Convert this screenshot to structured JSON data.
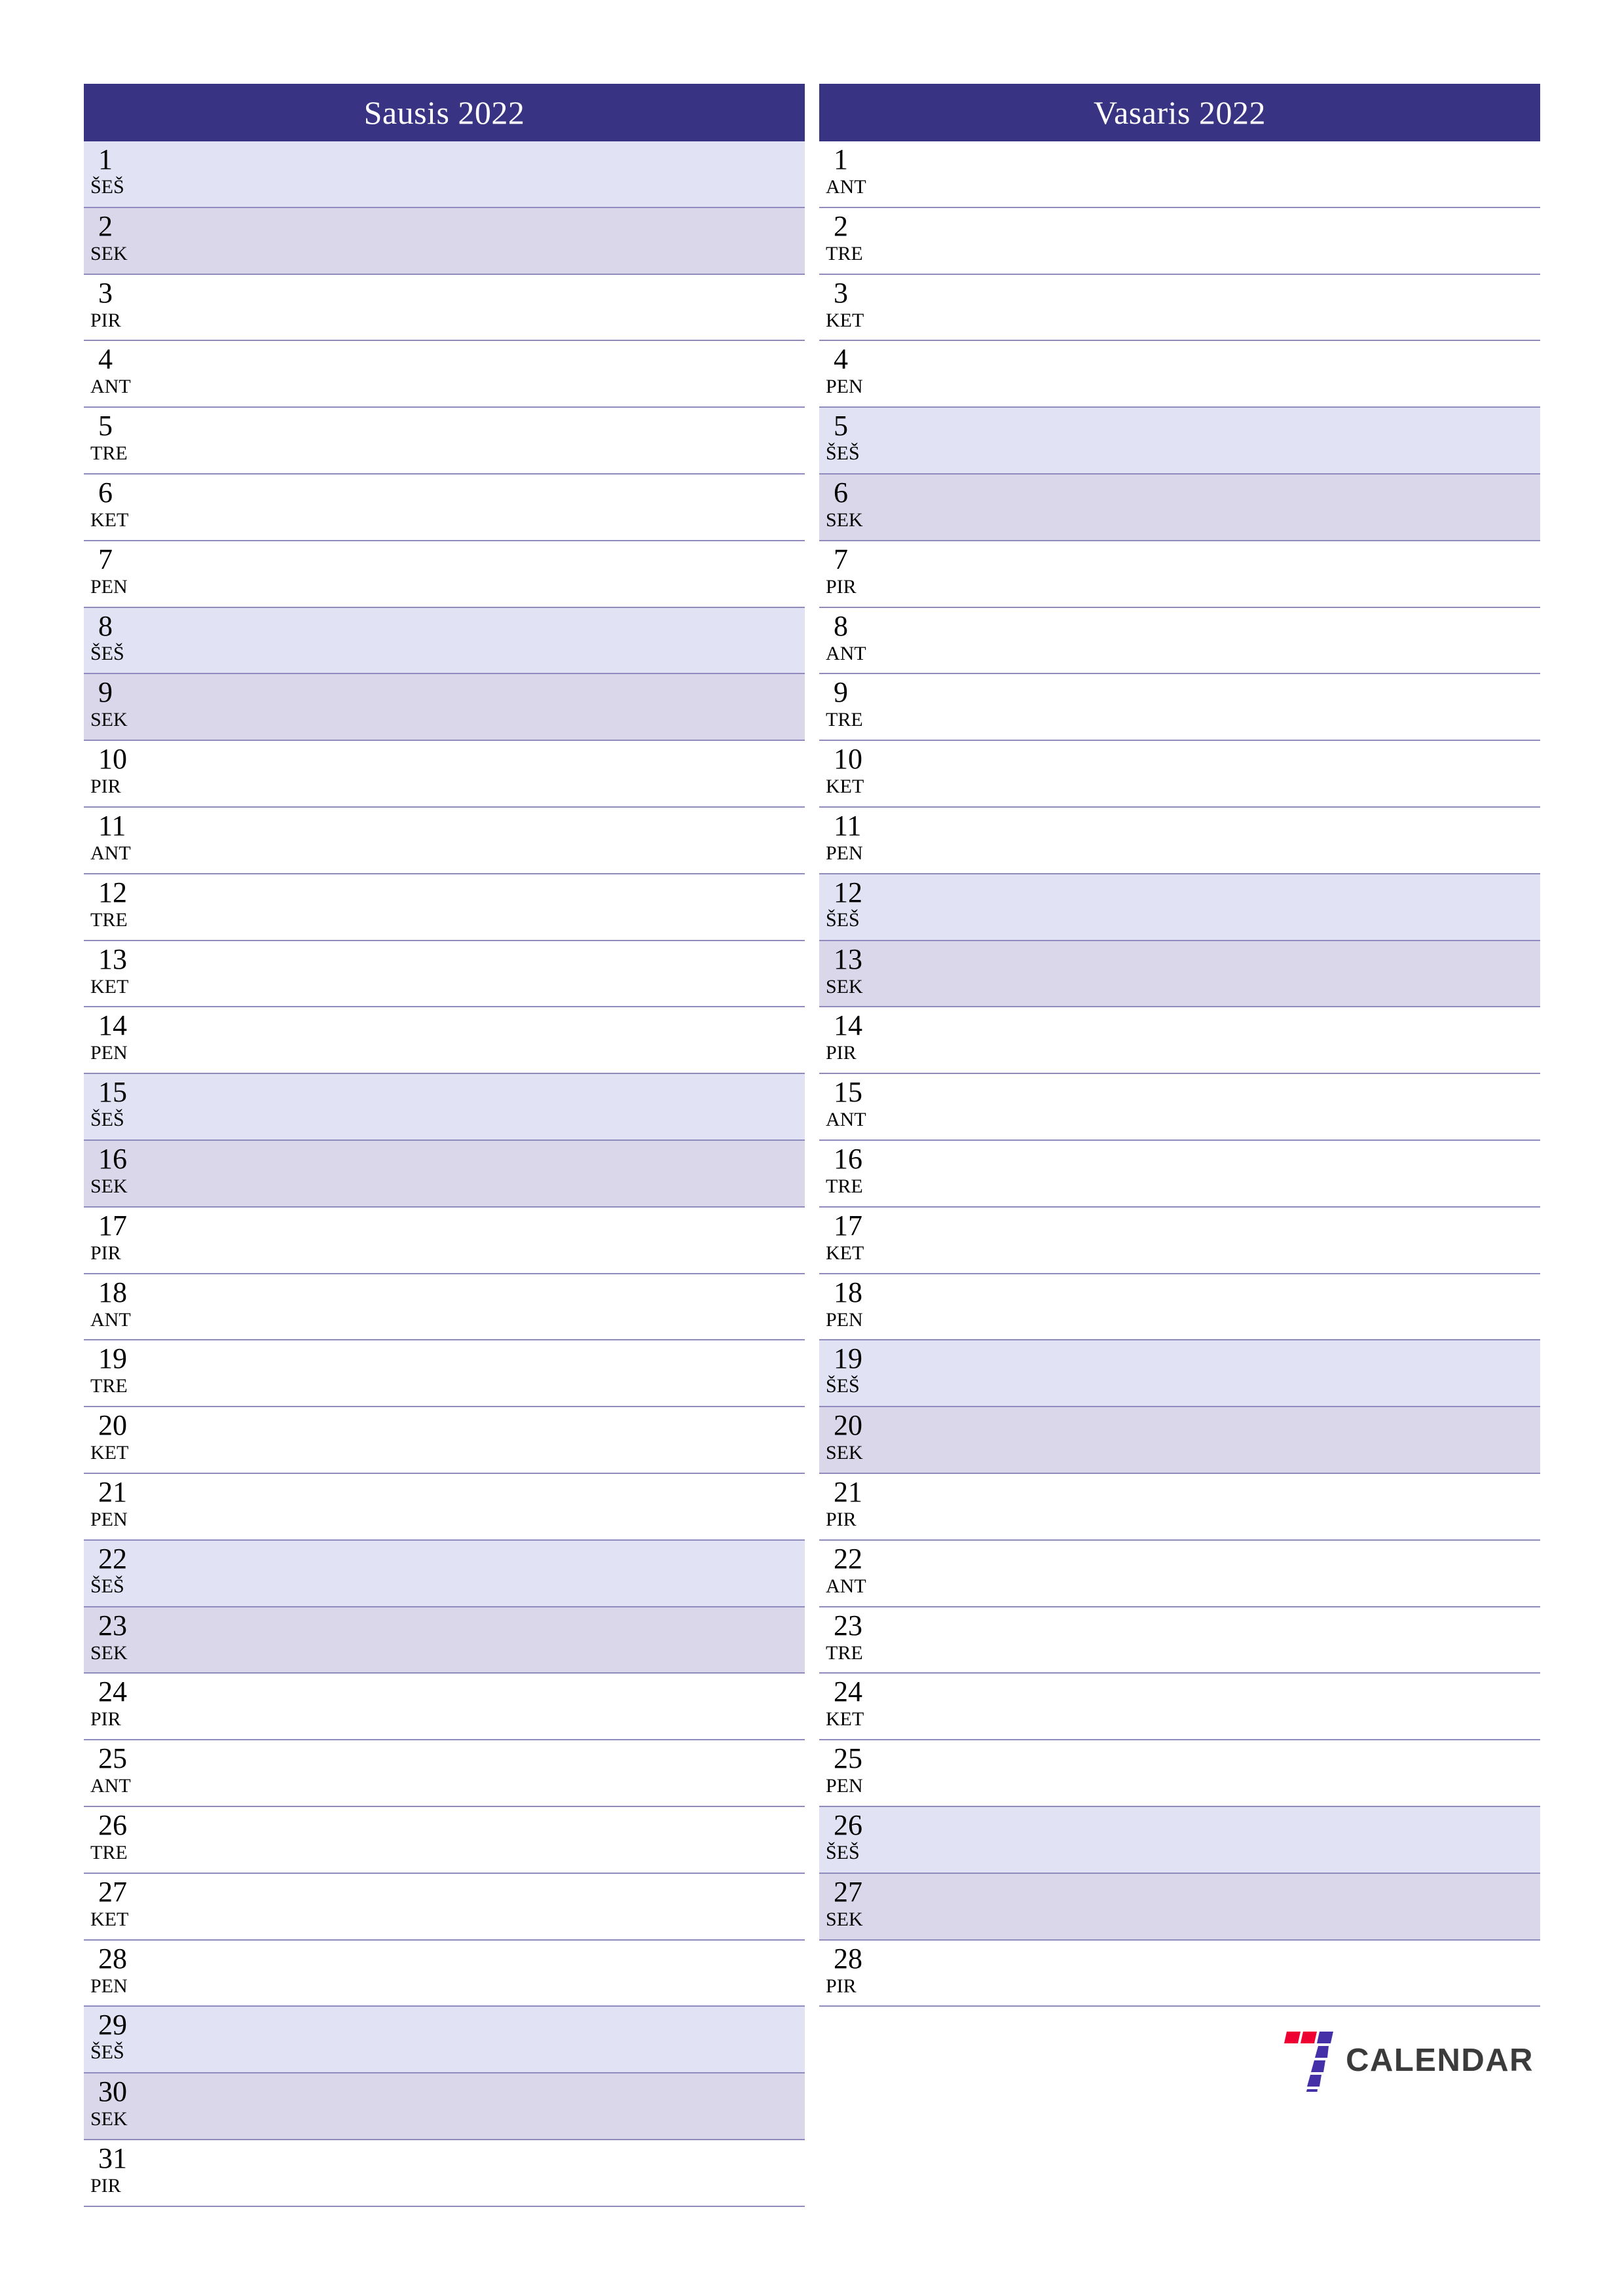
{
  "page": {
    "background": "#ffffff",
    "accent": "#383383",
    "saturday_shade": "#e2e2f5",
    "sunday_shade": "#dbd7eb",
    "row_border": "#8f8bbd"
  },
  "months": [
    {
      "title": "Sausis 2022",
      "days": [
        {
          "num": "1",
          "dow": "ŠEŠ",
          "type": "sat"
        },
        {
          "num": "2",
          "dow": "SEK",
          "type": "sun"
        },
        {
          "num": "3",
          "dow": "PIR",
          "type": "weekday"
        },
        {
          "num": "4",
          "dow": "ANT",
          "type": "weekday"
        },
        {
          "num": "5",
          "dow": "TRE",
          "type": "weekday"
        },
        {
          "num": "6",
          "dow": "KET",
          "type": "weekday"
        },
        {
          "num": "7",
          "dow": "PEN",
          "type": "weekday"
        },
        {
          "num": "8",
          "dow": "ŠEŠ",
          "type": "sat"
        },
        {
          "num": "9",
          "dow": "SEK",
          "type": "sun"
        },
        {
          "num": "10",
          "dow": "PIR",
          "type": "weekday"
        },
        {
          "num": "11",
          "dow": "ANT",
          "type": "weekday"
        },
        {
          "num": "12",
          "dow": "TRE",
          "type": "weekday"
        },
        {
          "num": "13",
          "dow": "KET",
          "type": "weekday"
        },
        {
          "num": "14",
          "dow": "PEN",
          "type": "weekday"
        },
        {
          "num": "15",
          "dow": "ŠEŠ",
          "type": "sat"
        },
        {
          "num": "16",
          "dow": "SEK",
          "type": "sun"
        },
        {
          "num": "17",
          "dow": "PIR",
          "type": "weekday"
        },
        {
          "num": "18",
          "dow": "ANT",
          "type": "weekday"
        },
        {
          "num": "19",
          "dow": "TRE",
          "type": "weekday"
        },
        {
          "num": "20",
          "dow": "KET",
          "type": "weekday"
        },
        {
          "num": "21",
          "dow": "PEN",
          "type": "weekday"
        },
        {
          "num": "22",
          "dow": "ŠEŠ",
          "type": "sat"
        },
        {
          "num": "23",
          "dow": "SEK",
          "type": "sun"
        },
        {
          "num": "24",
          "dow": "PIR",
          "type": "weekday"
        },
        {
          "num": "25",
          "dow": "ANT",
          "type": "weekday"
        },
        {
          "num": "26",
          "dow": "TRE",
          "type": "weekday"
        },
        {
          "num": "27",
          "dow": "KET",
          "type": "weekday"
        },
        {
          "num": "28",
          "dow": "PEN",
          "type": "weekday"
        },
        {
          "num": "29",
          "dow": "ŠEŠ",
          "type": "sat"
        },
        {
          "num": "30",
          "dow": "SEK",
          "type": "sun"
        },
        {
          "num": "31",
          "dow": "PIR",
          "type": "weekday"
        }
      ]
    },
    {
      "title": "Vasaris 2022",
      "days": [
        {
          "num": "1",
          "dow": "ANT",
          "type": "weekday"
        },
        {
          "num": "2",
          "dow": "TRE",
          "type": "weekday"
        },
        {
          "num": "3",
          "dow": "KET",
          "type": "weekday"
        },
        {
          "num": "4",
          "dow": "PEN",
          "type": "weekday"
        },
        {
          "num": "5",
          "dow": "ŠEŠ",
          "type": "sat"
        },
        {
          "num": "6",
          "dow": "SEK",
          "type": "sun"
        },
        {
          "num": "7",
          "dow": "PIR",
          "type": "weekday"
        },
        {
          "num": "8",
          "dow": "ANT",
          "type": "weekday"
        },
        {
          "num": "9",
          "dow": "TRE",
          "type": "weekday"
        },
        {
          "num": "10",
          "dow": "KET",
          "type": "weekday"
        },
        {
          "num": "11",
          "dow": "PEN",
          "type": "weekday"
        },
        {
          "num": "12",
          "dow": "ŠEŠ",
          "type": "sat"
        },
        {
          "num": "13",
          "dow": "SEK",
          "type": "sun"
        },
        {
          "num": "14",
          "dow": "PIR",
          "type": "weekday"
        },
        {
          "num": "15",
          "dow": "ANT",
          "type": "weekday"
        },
        {
          "num": "16",
          "dow": "TRE",
          "type": "weekday"
        },
        {
          "num": "17",
          "dow": "KET",
          "type": "weekday"
        },
        {
          "num": "18",
          "dow": "PEN",
          "type": "weekday"
        },
        {
          "num": "19",
          "dow": "ŠEŠ",
          "type": "sat"
        },
        {
          "num": "20",
          "dow": "SEK",
          "type": "sun"
        },
        {
          "num": "21",
          "dow": "PIR",
          "type": "weekday"
        },
        {
          "num": "22",
          "dow": "ANT",
          "type": "weekday"
        },
        {
          "num": "23",
          "dow": "TRE",
          "type": "weekday"
        },
        {
          "num": "24",
          "dow": "KET",
          "type": "weekday"
        },
        {
          "num": "25",
          "dow": "PEN",
          "type": "weekday"
        },
        {
          "num": "26",
          "dow": "ŠEŠ",
          "type": "sat"
        },
        {
          "num": "27",
          "dow": "SEK",
          "type": "sun"
        },
        {
          "num": "28",
          "dow": "PIR",
          "type": "weekday"
        }
      ]
    }
  ],
  "logo": {
    "mark_name": "seven-logo-icon",
    "word": "CALENDAR",
    "red": "#ee0033",
    "indigo": "#4530a8",
    "word_color": "#3b3b3b"
  }
}
